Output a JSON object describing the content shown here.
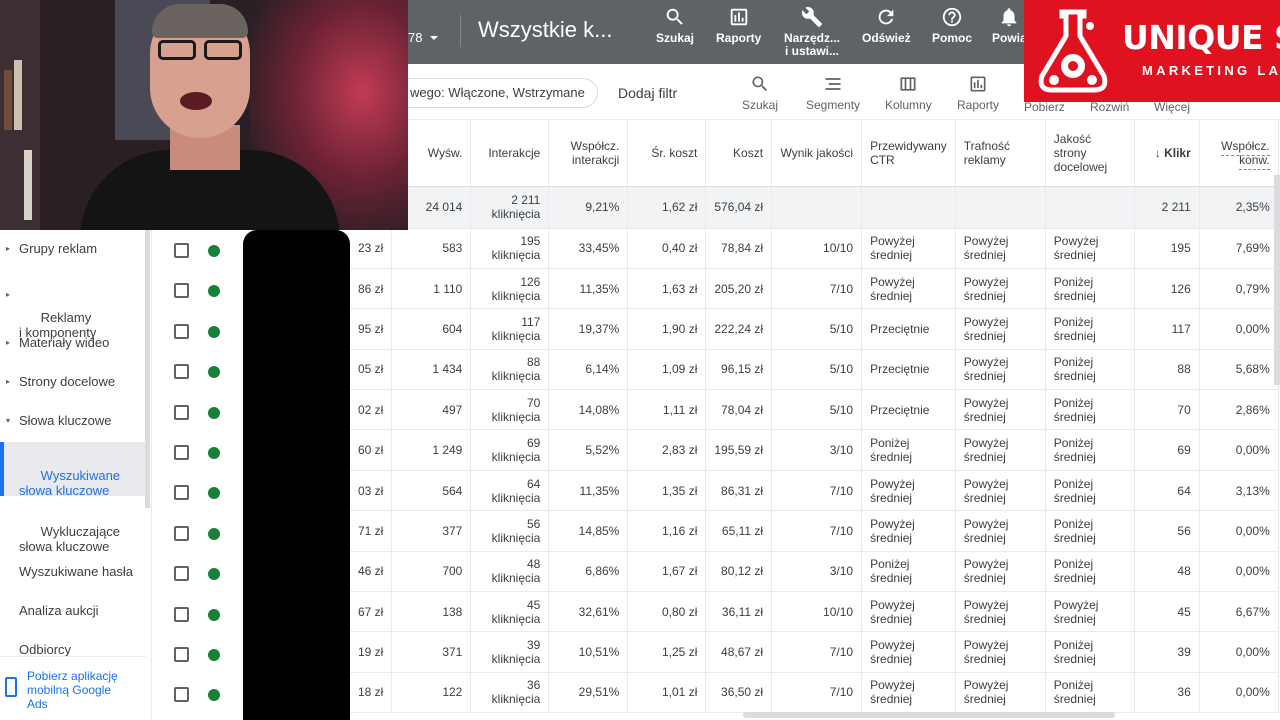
{
  "topbar": {
    "account_suffix": "78",
    "title": "Wszystkie k...",
    "buttons": [
      {
        "label": "Szukaj",
        "icon": "search-icon"
      },
      {
        "label": "Raporty",
        "icon": "reports-icon"
      },
      {
        "label": "Narzędz...\ni ustawi...",
        "icon": "tools-icon"
      },
      {
        "label": "Odśwież",
        "icon": "refresh-icon"
      },
      {
        "label": "Pomoc",
        "icon": "help-icon"
      },
      {
        "label": "Powia",
        "icon": "notifications-icon"
      }
    ]
  },
  "filterbar": {
    "chip": "wego: Włączone, Wstrzymane",
    "add_filter": "Dodaj filtr",
    "buttons": [
      {
        "label": "Szukaj",
        "icon": "search-icon"
      },
      {
        "label": "Segmenty",
        "icon": "segments-icon"
      },
      {
        "label": "Kolumny",
        "icon": "columns-icon"
      },
      {
        "label": "Raporty",
        "icon": "reports-icon"
      },
      {
        "label": "Pobierz",
        "icon": "download-icon"
      },
      {
        "label": "Rozwiń",
        "icon": "expand-icon"
      },
      {
        "label": "Więcej",
        "icon": "more-icon"
      }
    ]
  },
  "sidebar": {
    "items": [
      {
        "label": "Grupy reklam",
        "caret": "▸"
      },
      {
        "label": "Reklamy\ni komponenty",
        "caret": "▸"
      },
      {
        "label": "Materiały wideo",
        "caret": "▸"
      },
      {
        "label": "Strony docelowe",
        "caret": "▸"
      },
      {
        "label": "Słowa kluczowe",
        "caret": "▾"
      },
      {
        "label": "Wyszukiwane\nsłowa kluczowe",
        "caret": ""
      },
      {
        "label": "Wykluczające\nsłowa kluczowe",
        "caret": ""
      },
      {
        "label": "Wyszukiwane hasła",
        "caret": ""
      },
      {
        "label": "Analiza aukcji",
        "caret": ""
      },
      {
        "label": "Odbiorcy",
        "caret": ""
      }
    ],
    "app_download": "Pobierz aplikację\nmobilną Google\nAds"
  },
  "table": {
    "headers": [
      "",
      "Wyśw.",
      "Interakcje",
      "Współcz.\ninterakcji",
      "Śr. koszt",
      "Koszt",
      "Wynik jakości",
      "Przewidywany\nCTR",
      "Trafność\nreklamy",
      "Jakość\nstrony\ndocelowej",
      "Kliknięcia",
      "Współcz.\nkonw."
    ],
    "sorted_header_display": "Klikr",
    "total": [
      "",
      "24 014",
      "2 211\nkliknięcia",
      "9,21%",
      "1,62 zł",
      "576,04 zł",
      "",
      "",
      "",
      "",
      "2 211",
      "2,35%"
    ],
    "rows": [
      [
        "23 zł",
        "583",
        "195\nkliknięcia",
        "33,45%",
        "0,40 zł",
        "78,84 zł",
        "10/10",
        "Powyżej\nśredniej",
        "Powyżej\nśredniej",
        "Powyżej\nśredniej",
        "195",
        "7,69%"
      ],
      [
        "86 zł",
        "1 110",
        "126\nkliknięcia",
        "11,35%",
        "1,63 zł",
        "205,20 zł",
        "7/10",
        "Powyżej\nśredniej",
        "Powyżej\nśredniej",
        "Poniżej\nśredniej",
        "126",
        "0,79%"
      ],
      [
        "95 zł",
        "604",
        "117\nkliknięcia",
        "19,37%",
        "1,90 zł",
        "222,24 zł",
        "5/10",
        "Przeciętnie",
        "Powyżej\nśredniej",
        "Poniżej\nśredniej",
        "117",
        "0,00%"
      ],
      [
        "05 zł",
        "1 434",
        "88\nkliknięcia",
        "6,14%",
        "1,09 zł",
        "96,15 zł",
        "5/10",
        "Przeciętnie",
        "Powyżej\nśredniej",
        "Poniżej\nśredniej",
        "88",
        "5,68%"
      ],
      [
        "02 zł",
        "497",
        "70\nkliknięcia",
        "14,08%",
        "1,11 zł",
        "78,04 zł",
        "5/10",
        "Przeciętnie",
        "Powyżej\nśredniej",
        "Poniżej\nśredniej",
        "70",
        "2,86%"
      ],
      [
        "60 zł",
        "1 249",
        "69\nkliknięcia",
        "5,52%",
        "2,83 zł",
        "195,59 zł",
        "3/10",
        "Poniżej\nśredniej",
        "Powyżej\nśredniej",
        "Poniżej\nśredniej",
        "69",
        "0,00%"
      ],
      [
        "03 zł",
        "564",
        "64\nkliknięcia",
        "11,35%",
        "1,35 zł",
        "86,31 zł",
        "7/10",
        "Powyżej\nśredniej",
        "Powyżej\nśredniej",
        "Poniżej\nśredniej",
        "64",
        "3,13%"
      ],
      [
        "71 zł",
        "377",
        "56\nkliknięcia",
        "14,85%",
        "1,16 zł",
        "65,11 zł",
        "7/10",
        "Powyżej\nśredniej",
        "Powyżej\nśredniej",
        "Poniżej\nśredniej",
        "56",
        "0,00%"
      ],
      [
        "46 zł",
        "700",
        "48\nkliknięcia",
        "6,86%",
        "1,67 zł",
        "80,12 zł",
        "3/10",
        "Poniżej\nśredniej",
        "Powyżej\nśredniej",
        "Poniżej\nśredniej",
        "48",
        "0,00%"
      ],
      [
        "67 zł",
        "138",
        "45\nkliknięcia",
        "32,61%",
        "0,80 zł",
        "36,11 zł",
        "10/10",
        "Powyżej\nśredniej",
        "Powyżej\nśredniej",
        "Powyżej\nśredniej",
        "45",
        "6,67%"
      ],
      [
        "19 zł",
        "371",
        "39\nkliknięcia",
        "10,51%",
        "1,25 zł",
        "48,67 zł",
        "7/10",
        "Powyżej\nśredniej",
        "Powyżej\nśredniej",
        "Poniżej\nśredniej",
        "39",
        "0,00%"
      ],
      [
        "18 zł",
        "122",
        "36\nkliknięcia",
        "29,51%",
        "1,01 zł",
        "36,50 zł",
        "7/10",
        "Powyżej\nśredniej",
        "Powyżej\nśredniej",
        "Poniżej\nśredniej",
        "36",
        "0,00%"
      ]
    ]
  },
  "logo": {
    "brand": "UNIQUE SEO",
    "sub": "MARKETING LAB"
  },
  "colors": {
    "topbar": "#5f6368",
    "accent": "#1a73e8",
    "status_enabled": "#188038",
    "logo_bg": "#e0121f"
  }
}
